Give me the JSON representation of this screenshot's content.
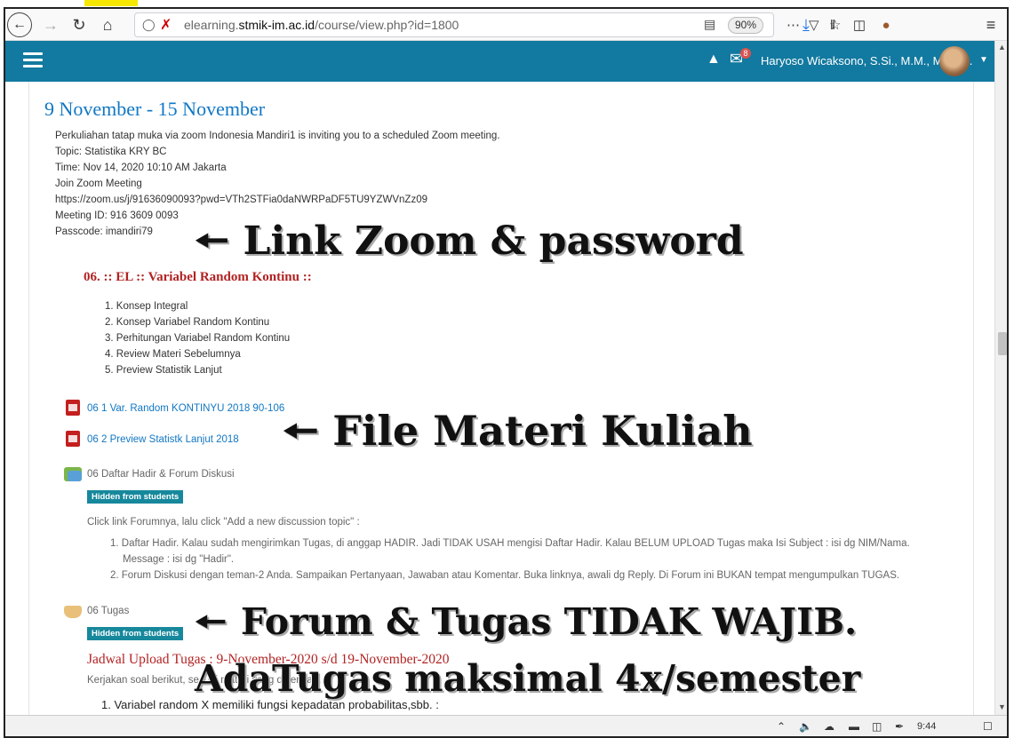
{
  "browser": {
    "url_prefix": "elearning.",
    "url_domain": "stmik-im.ac.id",
    "url_path": "/course/view.php?id=1800",
    "zoom": "90%"
  },
  "navbar": {
    "username": "Haryoso Wicaksono, S.Si., M.M., M.Kom.",
    "message_count": "8"
  },
  "section": {
    "title": "9 November - 15 November",
    "info_lines": [
      "Perkuliahan tatap muka via zoom Indonesia Mandiri1 is inviting you to a scheduled Zoom meeting.",
      "Topic: Statistika KRY BC",
      "Time: Nov 14, 2020 10:10 AM Jakarta",
      "Join Zoom Meeting",
      "https://zoom.us/j/91636090093?pwd=VTh2STFia0daNWRPaDF5TU9YZWVnZz09",
      "Meeting ID: 916 3609 0093",
      "Passcode: imandiri79"
    ]
  },
  "materi": {
    "title": "06. :: EL :: Variabel Random Kontinu ::",
    "items": [
      "1. Konsep Integral",
      "2. Konsep Variabel Random Kontinu",
      "3. Perhitungan Variabel Random Kontinu",
      "4. Review Materi Sebelumnya",
      "5. Preview Statistik Lanjut"
    ]
  },
  "files": [
    {
      "label": "06 1 Var. Random KONTINYU 2018 90-106",
      "icon": "pdf-icon"
    },
    {
      "label": "06 2 Preview Statistk Lanjut 2018",
      "icon": "pdf-icon"
    }
  ],
  "forum": {
    "label": "06 Daftar Hadir & Forum Diskusi",
    "badge": "Hidden from students",
    "intro": "Click link Forumnya, lalu click \"Add a new discussion topic\" :",
    "item1_line1": "1. Daftar Hadir. Kalau sudah mengirimkan Tugas, di anggap HADIR. Jadi TIDAK USAH mengisi Daftar Hadir. Kalau BELUM UPLOAD Tugas maka Isi Subject : isi dg NIM/Nama.",
    "item1_line2": "Message : isi dg \"Hadir\".",
    "item2": "2. Forum Diskusi dengan teman-2 Anda. Sampaikan Pertanyaan, Jawaban atau Komentar. Buka linknya, awali dg Reply. Di Forum ini BUKAN tempat mengumpulkan TUGAS."
  },
  "tugas": {
    "label": "06 Tugas",
    "badge": "Hidden from students",
    "schedule": "Jadwal Upload Tugas : 9-November-2020 s/d 19-November-2020",
    "instruction": "Kerjakan soal berikut, sesuai materi yang diberikan.",
    "question1": "1.   Variabel random X memiliki fungsi kepadatan probabilitas,sbb. :"
  },
  "annotations": {
    "zoom": "Link Zoom & password",
    "files": "File Materi Kuliah",
    "forum": "Forum & Tugas TIDAK WAJIB.",
    "tugas": "AdaTugas maksimal 4x/semester"
  },
  "taskbar": {
    "time": "9:44"
  }
}
